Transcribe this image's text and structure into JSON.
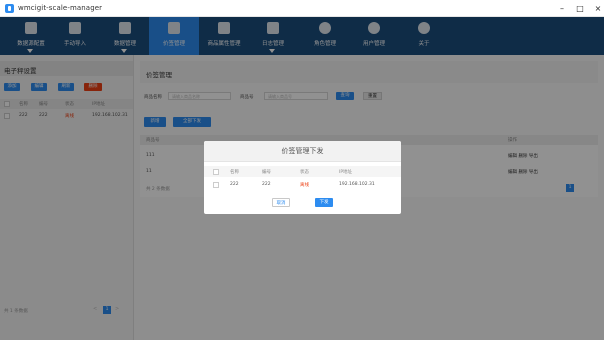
{
  "window": {
    "title": "wmcigit-scale-manager",
    "min": "–",
    "max": "□",
    "close": "×"
  },
  "nav": {
    "items": [
      {
        "label": "数据源配置",
        "icon": "database-icon",
        "caret": true
      },
      {
        "label": "手动导入",
        "icon": "folder-upload-icon",
        "caret": false
      },
      {
        "label": "数据管理",
        "icon": "settings-icon",
        "caret": true
      },
      {
        "label": "价签管理",
        "icon": "price-tag-icon",
        "caret": false,
        "active": true
      },
      {
        "label": "商品属性管理",
        "icon": "grid-table-icon",
        "caret": false
      },
      {
        "label": "日志管理",
        "icon": "calendar-icon",
        "caret": true
      },
      {
        "label": "角色管理",
        "icon": "role-icon",
        "caret": false
      },
      {
        "label": "用户管理",
        "icon": "user-icon",
        "caret": false
      },
      {
        "label": "关于",
        "icon": "info-icon",
        "caret": false
      }
    ]
  },
  "left": {
    "title": "电子秤设置",
    "buttons": {
      "add": "添加",
      "edit": "编辑",
      "refresh": "刷新",
      "delete": "删除"
    },
    "table": {
      "headers": [
        "名称",
        "编号",
        "状态",
        "IP地址"
      ],
      "rows": [
        {
          "name": "222",
          "code": "222",
          "status": "离线",
          "ip": "192.168.102.31"
        }
      ]
    },
    "footer": "共 1 条数据",
    "pager": {
      "prev": "<",
      "page": "1",
      "next": ">"
    }
  },
  "main": {
    "title": "价签管理",
    "form": {
      "name_label": "商品名称",
      "name_placeholder": "请输入商品名称",
      "code_label": "商品号",
      "code_placeholder": "请输入商品号",
      "search": "查询",
      "reset": "重置"
    },
    "toolbar": {
      "add": "新增",
      "issue_all": "全部下发"
    },
    "table": {
      "headers": [
        "商品号",
        "操作"
      ],
      "rows": [
        {
          "code": "111",
          "actions": [
            "编辑",
            "删除",
            "导出"
          ]
        },
        {
          "code": "11",
          "actions": [
            "编辑",
            "删除",
            "导出"
          ]
        }
      ]
    },
    "footer": "共 2 条数据",
    "pager": {
      "page": "1"
    }
  },
  "modal": {
    "title": "价签管理下发",
    "headers": [
      "名称",
      "编号",
      "状态",
      "IP地址"
    ],
    "rows": [
      {
        "name": "222",
        "code": "222",
        "status": "离线",
        "ip": "192.168.102.31"
      }
    ],
    "cancel": "取消",
    "ok": "下发"
  },
  "colors": {
    "nav_bg": "#1c4e7e",
    "nav_active": "#2d8cf0",
    "primary": "#2d8cf0",
    "danger": "#ed4014"
  }
}
